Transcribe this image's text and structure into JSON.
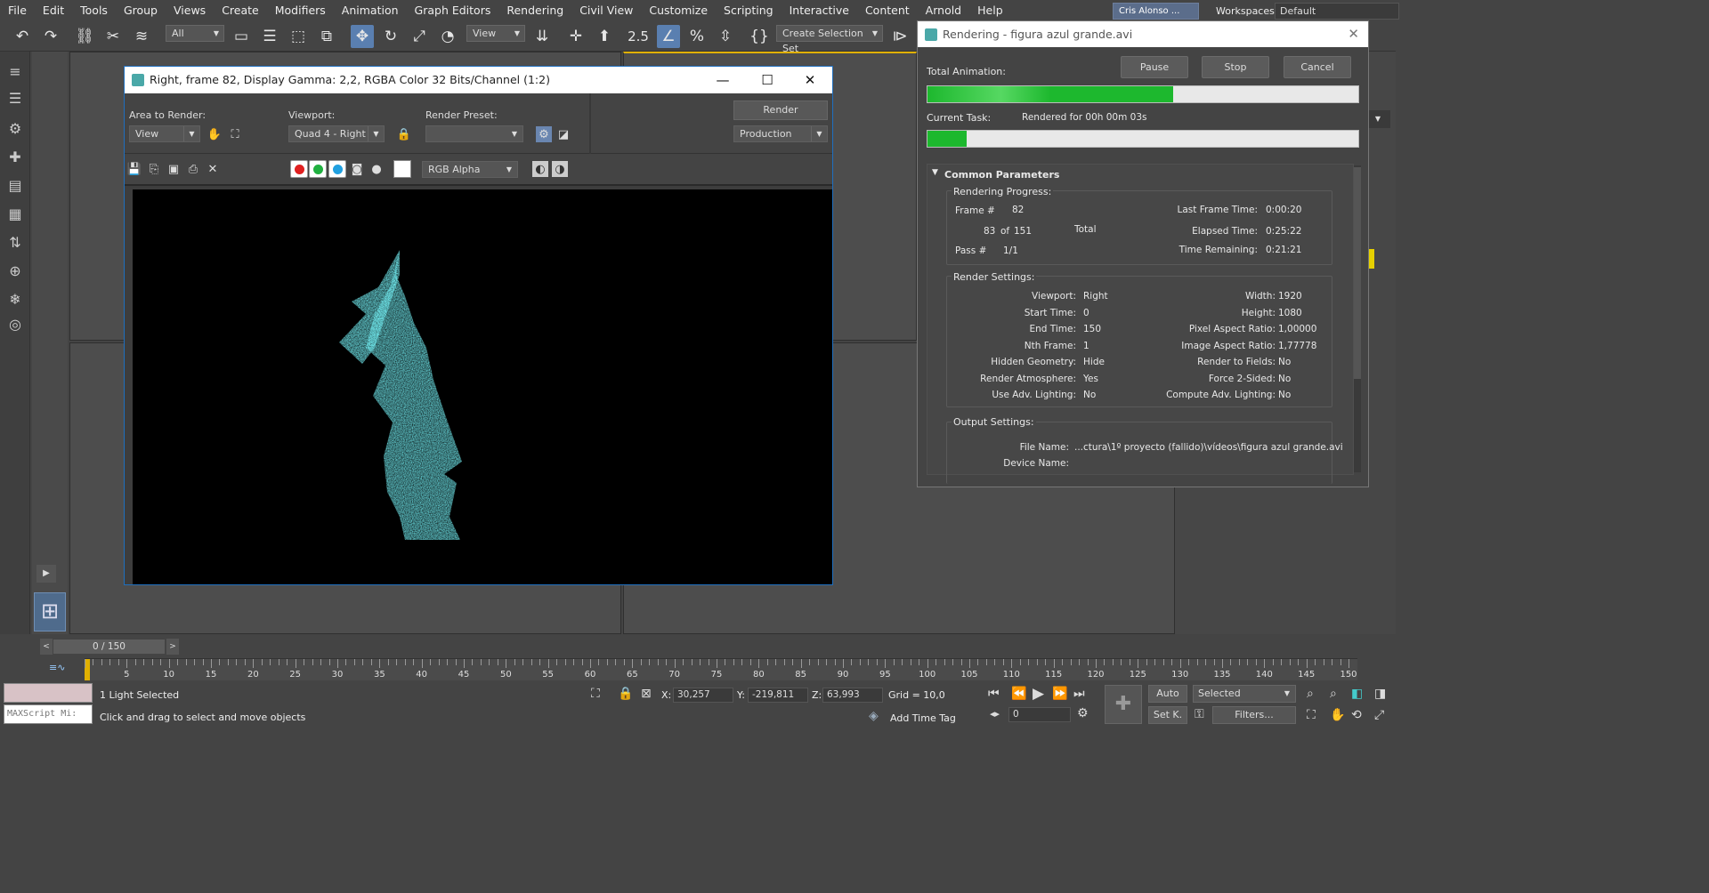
{
  "menu": [
    "File",
    "Edit",
    "Tools",
    "Group",
    "Views",
    "Create",
    "Modifiers",
    "Animation",
    "Graph Editors",
    "Rendering",
    "Civil View",
    "Customize",
    "Scripting",
    "Interactive",
    "Content",
    "Arnold",
    "Help"
  ],
  "user": "Cris Alonso ...",
  "workspaces": {
    "label": "Workspaces:",
    "value": "Default"
  },
  "toolbar": {
    "filter": "All",
    "viewport_ref": "View",
    "snap_value": "2.5",
    "selection_set": "Create Selection Set"
  },
  "frame_window": {
    "title": "Right, frame 82, Display Gamma: 2,2, RGBA Color 32 Bits/Channel (1:2)",
    "area_label": "Area to Render:",
    "area_value": "View",
    "viewport_label": "Viewport:",
    "viewport_value": "Quad 4 - Right",
    "preset_label": "Render Preset:",
    "preset_value": "",
    "render_button": "Render",
    "production": "Production",
    "channel": "RGB Alpha"
  },
  "render_dialog": {
    "title": "Rendering - figura azul grande.avi",
    "pause": "Pause",
    "stop": "Stop",
    "cancel": "Cancel",
    "total_animation": "Total Animation:",
    "total_progress": 0.57,
    "current_task": "Current Task:",
    "current_task_value": "Rendered for 00h 00m 03s",
    "current_progress": 0.09,
    "common_params": "Common Parameters",
    "progress_group": "Rendering Progress:",
    "frame_label": "Frame #",
    "frame_value": "82",
    "count_value": "83",
    "of_label": "of",
    "total_frames": "151",
    "total_label": "Total",
    "pass_label": "Pass #",
    "pass_value": "1/1",
    "last_frame_time_label": "Last Frame Time:",
    "last_frame_time": "0:00:20",
    "elapsed_label": "Elapsed Time:",
    "elapsed": "0:25:22",
    "remaining_label": "Time Remaining:",
    "remaining": "0:21:21",
    "settings_group": "Render Settings:",
    "settings_left": [
      {
        "k": "Viewport:",
        "v": "Right"
      },
      {
        "k": "Start Time:",
        "v": "0"
      },
      {
        "k": "End Time:",
        "v": "150"
      },
      {
        "k": "Nth Frame:",
        "v": "1"
      },
      {
        "k": "Hidden Geometry:",
        "v": "Hide"
      },
      {
        "k": "Render Atmosphere:",
        "v": "Yes"
      },
      {
        "k": "Use Adv. Lighting:",
        "v": "No"
      }
    ],
    "settings_right": [
      {
        "k": "Width:",
        "v": "1920"
      },
      {
        "k": "Height:",
        "v": "1080"
      },
      {
        "k": "Pixel Aspect Ratio:",
        "v": "1,00000"
      },
      {
        "k": "Image Aspect Ratio:",
        "v": "1,77778"
      },
      {
        "k": "Render to Fields:",
        "v": "No"
      },
      {
        "k": "Force 2-Sided:",
        "v": "No"
      },
      {
        "k": "Compute Adv. Lighting:",
        "v": "No"
      }
    ],
    "output_group": "Output Settings:",
    "file_name_label": "File Name:",
    "file_name": "...ctura\\1º proyecto (fallido)\\vídeos\\figura azul grande.avi",
    "device_label": "Device Name:"
  },
  "timeline": {
    "slider": "0 / 150",
    "ticks": [
      "5",
      "10",
      "15",
      "20",
      "25",
      "30",
      "35",
      "40",
      "45",
      "50",
      "55",
      "60",
      "65",
      "70",
      "75",
      "80",
      "85",
      "90",
      "95",
      "100",
      "105",
      "110",
      "115",
      "120",
      "125",
      "130",
      "135",
      "140",
      "145",
      "150"
    ]
  },
  "status": {
    "maxscript": "MAXScript Mi:",
    "selection": "1 Light Selected",
    "prompt": "Click and drag to select and move objects",
    "x_label": "X:",
    "x": "30,257",
    "y_label": "Y:",
    "y": "-219,811",
    "z_label": "Z:",
    "z": "63,993",
    "grid": "Grid = 10,0",
    "add_time_tag": "Add Time Tag",
    "auto": "Auto",
    "set_key": "Set K.",
    "selected": "Selected",
    "filters": "Filters...",
    "frame_field": "0"
  },
  "colors": {
    "accent": "#1db82e",
    "particles": "#2ee6f0",
    "title_border": "#1f6fbf"
  }
}
